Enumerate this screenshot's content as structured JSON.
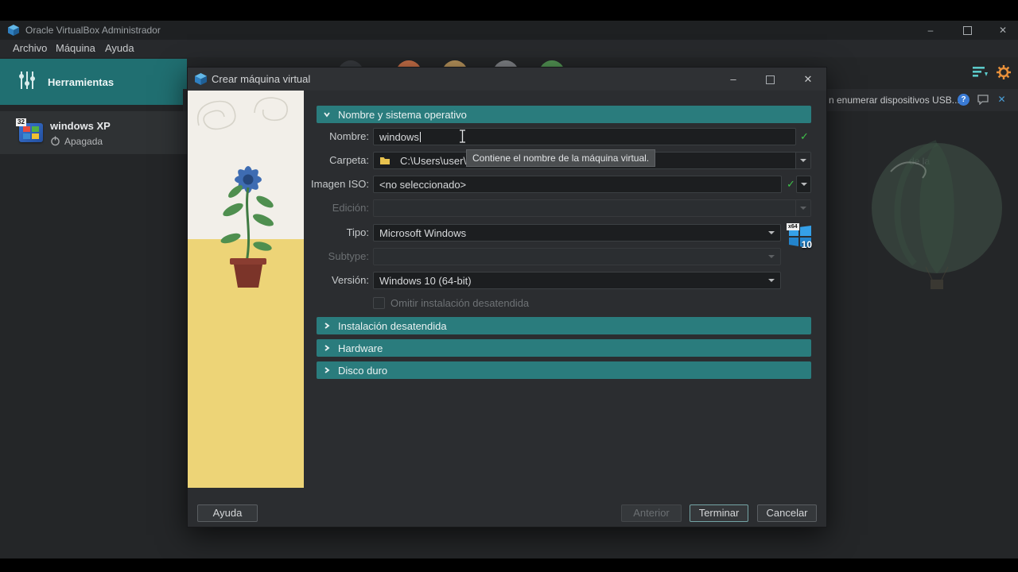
{
  "window": {
    "title": "Oracle VirtualBox Administrador",
    "menus": [
      "Archivo",
      "Máquina",
      "Ayuda"
    ]
  },
  "sidebar": {
    "tools_label": "Herramientas",
    "vm_name": "windows XP",
    "vm_status": "Apagada",
    "vm_badge": "32"
  },
  "main": {
    "notification_text": "n enumerar dispositivos USB...",
    "faint_text": "de la"
  },
  "dialog": {
    "title": "Crear máquina virtual",
    "section_name_os": "Nombre y sistema operativo",
    "section_unattended": "Instalación desatendida",
    "section_hardware": "Hardware",
    "section_disk": "Disco duro",
    "name_label": "Nombre:",
    "name_value": "windows",
    "folder_label": "Carpeta:",
    "folder_value": "C:\\Users\\user\\Vir",
    "iso_label": "Imagen ISO:",
    "iso_value": "<no seleccionado>",
    "edition_label": "Edición:",
    "type_label": "Tipo:",
    "type_value": "Microsoft Windows",
    "subtype_label": "Subtype:",
    "version_label": "Versión:",
    "version_value": "Windows 10 (64-bit)",
    "skip_unattended": "Omitir instalación desatendida",
    "tooltip": "Contiene el nombre de la máquina virtual.",
    "os_badge": "x64",
    "os_number": "10",
    "help_btn": "Ayuda",
    "back_btn": "Anterior",
    "finish_btn": "Terminar",
    "cancel_btn": "Cancelar"
  },
  "icons": {
    "check": "✓",
    "close": "✕",
    "minimize": "–",
    "question": "?"
  },
  "colors": {
    "accent_teal": "#2a7c7d",
    "check_green": "#3fc24a",
    "folder_yellow": "#e8c24e"
  }
}
